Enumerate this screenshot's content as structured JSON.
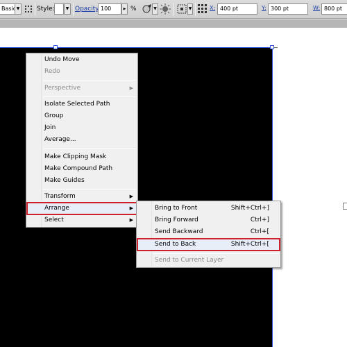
{
  "control_bar": {
    "basic_value": "Basic",
    "style_label": "Style:",
    "opacity_label": "Opacity:",
    "opacity_value": "100",
    "opacity_unit": "%",
    "x_label": "X:",
    "x_value": "400 pt",
    "y_label": "Y:",
    "y_value": "300 pt",
    "w_label": "W:",
    "w_value": "800 pt"
  },
  "context_menu": {
    "items": [
      {
        "label": "Undo Move",
        "enabled": true
      },
      {
        "label": "Redo",
        "enabled": false
      },
      {
        "label": "Perspective",
        "enabled": false,
        "submenu": true
      },
      {
        "label": "Isolate Selected Path",
        "enabled": true
      },
      {
        "label": "Group",
        "enabled": true
      },
      {
        "label": "Join",
        "enabled": true
      },
      {
        "label": "Average...",
        "enabled": true
      },
      {
        "label": "Make Clipping Mask",
        "enabled": true
      },
      {
        "label": "Make Compound Path",
        "enabled": true
      },
      {
        "label": "Make Guides",
        "enabled": true
      },
      {
        "label": "Transform",
        "enabled": true,
        "submenu": true
      },
      {
        "label": "Arrange",
        "enabled": true,
        "submenu": true,
        "highlighted": true
      },
      {
        "label": "Select",
        "enabled": true,
        "submenu": true
      }
    ],
    "submenu_arrow": "▶"
  },
  "arrange_submenu": {
    "items": [
      {
        "label": "Bring to Front",
        "shortcut": "Shift+Ctrl+]",
        "enabled": true
      },
      {
        "label": "Bring Forward",
        "shortcut": "Ctrl+]",
        "enabled": true
      },
      {
        "label": "Send Backward",
        "shortcut": "Ctrl+[",
        "enabled": true
      },
      {
        "label": "Send to Back",
        "shortcut": "Shift+Ctrl+[",
        "enabled": true,
        "highlighted": true
      },
      {
        "label": "Send to Current Layer",
        "shortcut": "",
        "enabled": false
      }
    ]
  },
  "colors": {
    "highlight_border": "#d0202b",
    "selection": "#3153d7",
    "artwork": "#000000",
    "menu_bg": "#f0f0f0"
  },
  "icons": [
    "dropdown-arrow-icon",
    "grid-dots-icon",
    "recolor-icon",
    "globe-icon",
    "align-grid-icon",
    "reference-point-icon"
  ]
}
